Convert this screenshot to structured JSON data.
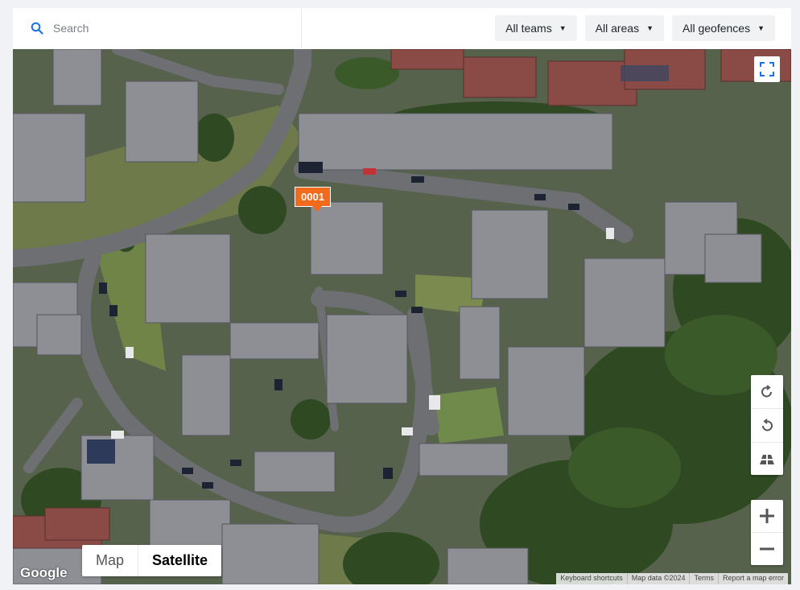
{
  "search": {
    "placeholder": "Search"
  },
  "filters": {
    "teams": "All teams",
    "areas": "All areas",
    "geofences": "All geofences"
  },
  "map": {
    "marker_label": "0001",
    "map_type": {
      "map": "Map",
      "satellite": "Satellite",
      "selected": "Satellite"
    },
    "logo": "Google",
    "attribution": {
      "shortcuts": "Keyboard shortcuts",
      "data": "Map data ©2024",
      "terms": "Terms",
      "report": "Report a map error"
    },
    "icons": {
      "search": "search-icon",
      "fullscreen": "fullscreen-icon",
      "rotate_cw": "rotate-clockwise-icon",
      "rotate_ccw": "rotate-counterclockwise-icon",
      "tilt": "tilt-icon",
      "zoom_in": "plus-icon",
      "zoom_out": "minus-icon"
    },
    "colors": {
      "accent": "#1a73e8",
      "marker": "#f26a1b"
    }
  }
}
